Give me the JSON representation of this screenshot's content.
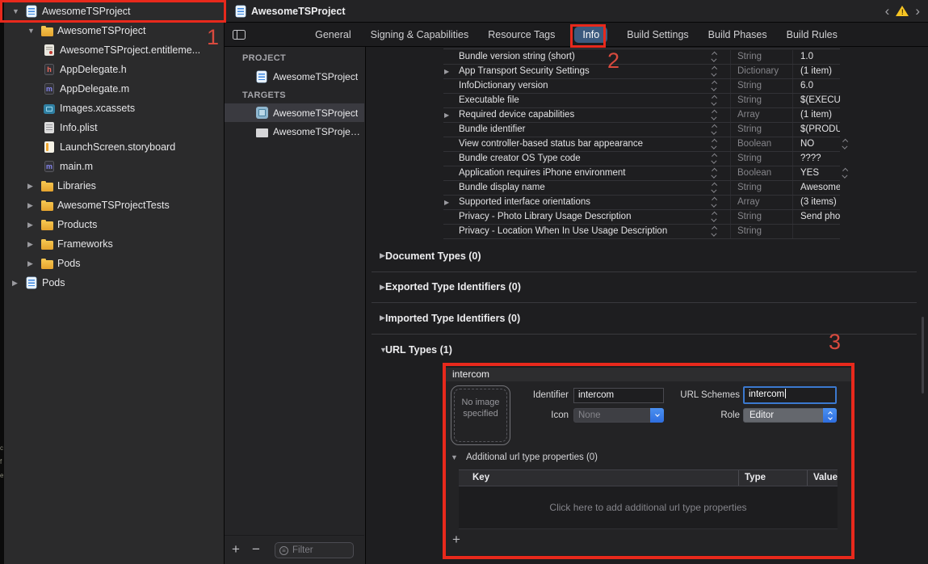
{
  "window_tab": {
    "title": "AwesomeTSProject"
  },
  "nav_controls": {
    "back": "‹",
    "forward": "›",
    "warning_mark": "!"
  },
  "toolbar": {
    "tabs": [
      "General",
      "Signing & Capabilities",
      "Resource Tags",
      "Info",
      "Build Settings",
      "Build Phases",
      "Build Rules"
    ],
    "selected_tab": "Info"
  },
  "navigator": {
    "items": [
      {
        "label": "AwesomeTSProject",
        "icon": "project",
        "level": 0,
        "disclosure": "open"
      },
      {
        "label": "AwesomeTSProject",
        "icon": "folder",
        "level": 1,
        "disclosure": "open"
      },
      {
        "label": "AwesomeTSProject.entitleme...",
        "icon": "entitlements",
        "level": 2,
        "disclosure": null
      },
      {
        "label": "AppDelegate.h",
        "icon": "file-h",
        "level": 2,
        "disclosure": null
      },
      {
        "label": "AppDelegate.m",
        "icon": "file-m",
        "level": 2,
        "disclosure": null
      },
      {
        "label": "Images.xcassets",
        "icon": "xcassets",
        "level": 2,
        "disclosure": null
      },
      {
        "label": "Info.plist",
        "icon": "plist",
        "level": 2,
        "disclosure": null
      },
      {
        "label": "LaunchScreen.storyboard",
        "icon": "storyboard",
        "level": 2,
        "disclosure": null
      },
      {
        "label": "main.m",
        "icon": "file-m",
        "level": 2,
        "disclosure": null
      },
      {
        "label": "Libraries",
        "icon": "folder",
        "level": 1,
        "disclosure": "closed"
      },
      {
        "label": "AwesomeTSProjectTests",
        "icon": "folder",
        "level": 1,
        "disclosure": "closed"
      },
      {
        "label": "Products",
        "icon": "folder",
        "level": 1,
        "disclosure": "closed"
      },
      {
        "label": "Frameworks",
        "icon": "folder",
        "level": 1,
        "disclosure": "closed"
      },
      {
        "label": "Pods",
        "icon": "folder",
        "level": 1,
        "disclosure": "closed"
      },
      {
        "label": "Pods",
        "icon": "project",
        "level": 0,
        "disclosure": "closed"
      }
    ]
  },
  "project_panel": {
    "project_header": "PROJECT",
    "project_item": "AwesomeTSProject",
    "targets_header": "TARGETS",
    "targets": [
      {
        "label": "AwesomeTSProject",
        "icon": "app-target",
        "selected": true
      },
      {
        "label": "AwesomeTSProject...",
        "icon": "test-target",
        "selected": false
      }
    ],
    "add_label": "+",
    "remove_label": "−",
    "filter_placeholder": "Filter"
  },
  "info_editor": {
    "rows": [
      {
        "key": "Bundle version string (short)",
        "type": "String",
        "value": "1.0",
        "disclosure": false,
        "bool": false
      },
      {
        "key": "App Transport Security Settings",
        "type": "Dictionary",
        "value": "(1 item)",
        "disclosure": true,
        "bool": false
      },
      {
        "key": "InfoDictionary version",
        "type": "String",
        "value": "6.0",
        "disclosure": false,
        "bool": false
      },
      {
        "key": "Executable file",
        "type": "String",
        "value": "$(EXECU",
        "disclosure": false,
        "bool": false
      },
      {
        "key": "Required device capabilities",
        "type": "Array",
        "value": "(1 item)",
        "disclosure": true,
        "bool": false
      },
      {
        "key": "Bundle identifier",
        "type": "String",
        "value": "$(PRODU",
        "disclosure": false,
        "bool": false
      },
      {
        "key": "View controller-based status bar appearance",
        "type": "Boolean",
        "value": "NO",
        "disclosure": false,
        "bool": true
      },
      {
        "key": "Bundle creator OS Type code",
        "type": "String",
        "value": "????",
        "disclosure": false,
        "bool": false
      },
      {
        "key": "Application requires iPhone environment",
        "type": "Boolean",
        "value": "YES",
        "disclosure": false,
        "bool": true
      },
      {
        "key": "Bundle display name",
        "type": "String",
        "value": "Awesome",
        "disclosure": false,
        "bool": false
      },
      {
        "key": "Supported interface orientations",
        "type": "Array",
        "value": "(3 items)",
        "disclosure": true,
        "bool": false
      },
      {
        "key": "Privacy - Photo Library Usage Description",
        "type": "String",
        "value": "Send pho",
        "disclosure": false,
        "bool": false
      },
      {
        "key": "Privacy - Location When In Use Usage Description",
        "type": "String",
        "value": "",
        "disclosure": false,
        "bool": false
      }
    ],
    "sections": [
      {
        "label": "Document Types (0)",
        "expanded": false
      },
      {
        "label": "Exported Type Identifiers (0)",
        "expanded": false
      },
      {
        "label": "Imported Type Identifiers (0)",
        "expanded": false
      },
      {
        "label": "URL Types (1)",
        "expanded": true
      }
    ],
    "url_type": {
      "name": "intercom",
      "image_placeholder": "No image specified",
      "identifier_label": "Identifier",
      "identifier_value": "intercom",
      "icon_label": "Icon",
      "icon_value": "None",
      "url_schemes_label": "URL Schemes",
      "url_schemes_value": "intercom",
      "role_label": "Role",
      "role_value": "Editor",
      "additional_header": "Additional url type properties (0)",
      "columns": [
        "Key",
        "Type",
        "Value"
      ],
      "empty_message": "Click here to add additional url type properties",
      "add_label": "+"
    }
  },
  "annotations": {
    "label_1": "1",
    "label_2": "2",
    "label_3": "3"
  },
  "colors": {
    "annotation_red": "#e8291c",
    "selected_tab_blue": "#3c5a7e",
    "focus_ring_blue": "#3b79cf",
    "warning_yellow": "#f6c423"
  }
}
